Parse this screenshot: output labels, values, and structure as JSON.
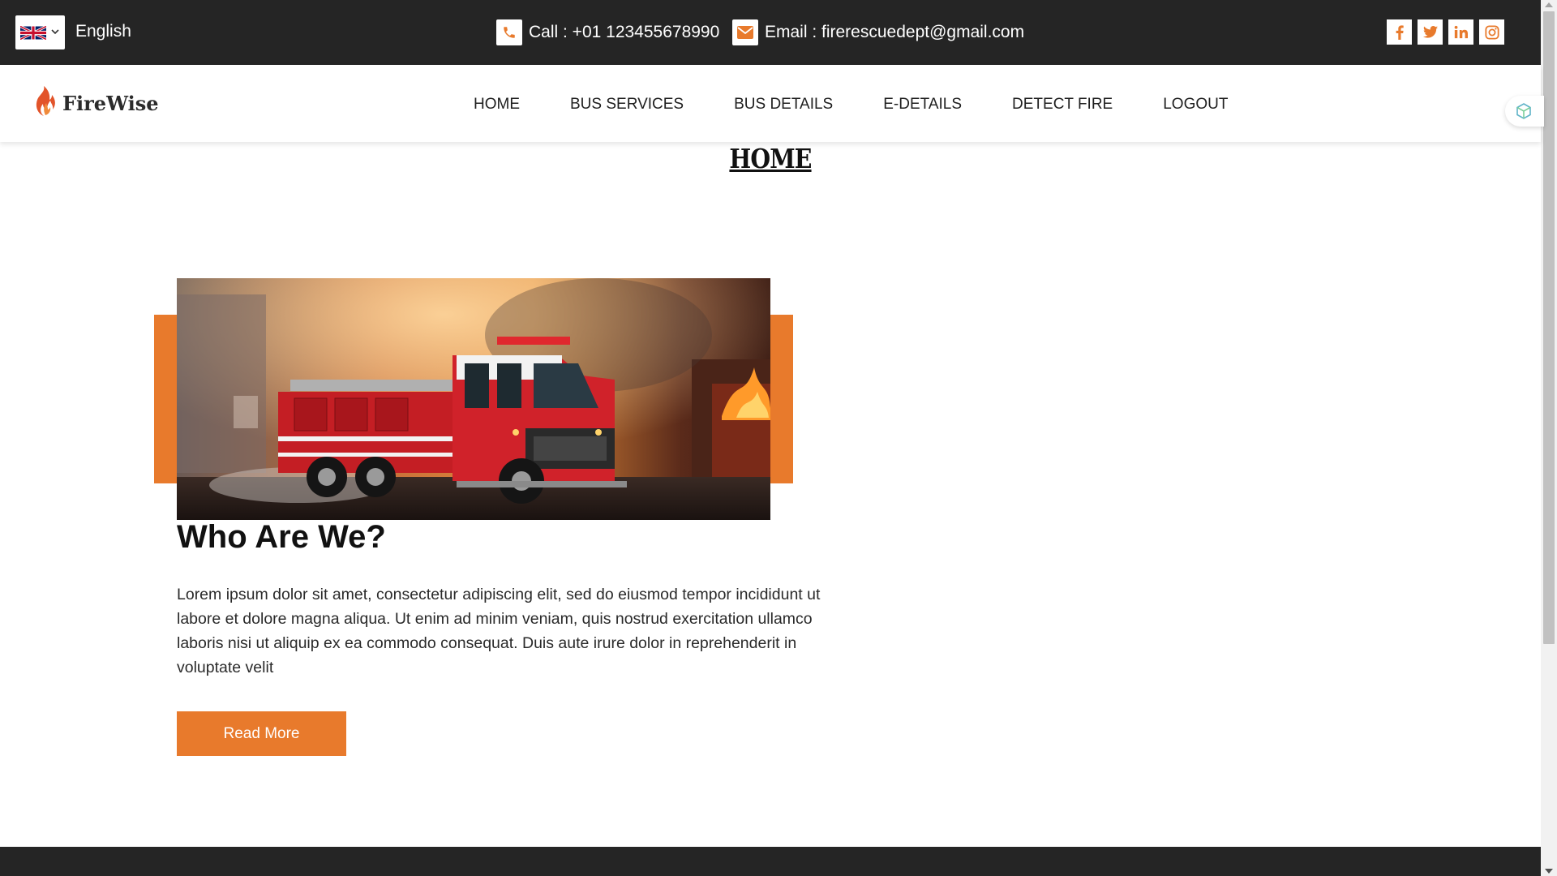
{
  "topbar": {
    "language": {
      "label": "English",
      "flag_icon": "uk-flag-icon"
    },
    "call": {
      "text": "Call : +01 123455678990",
      "icon": "phone-icon"
    },
    "email": {
      "text": "Email : firerescuedept@gmail.com",
      "icon": "envelope-icon"
    },
    "socials": [
      "facebook-icon",
      "twitter-icon",
      "linkedin-icon",
      "instagram-icon"
    ]
  },
  "navbar": {
    "brand": "FireWise",
    "items": [
      {
        "label": "HOME"
      },
      {
        "label": "BUS SERVICES"
      },
      {
        "label": "BUS DETAILS"
      },
      {
        "label": "E-DETAILS"
      },
      {
        "label": "DETECT FIRE"
      },
      {
        "label": "LOGOUT"
      }
    ]
  },
  "page": {
    "title": "HOME"
  },
  "about": {
    "heading": "Who Are We?",
    "text": "Lorem ipsum dolor sit amet, consectetur adipiscing elit, sed do eiusmod tempor incididunt ut labore et dolore magna aliqua. Ut enim ad minim veniam, quis nostrud exercitation ullamco laboris nisi ut aliquip ex ea commodo consequat. Duis aute irure dolor in reprehenderit in voluptate velit",
    "button_label": "Read More",
    "image": "fire-truck-image"
  },
  "colors": {
    "accent": "#e87a2c",
    "dark": "#252525"
  }
}
